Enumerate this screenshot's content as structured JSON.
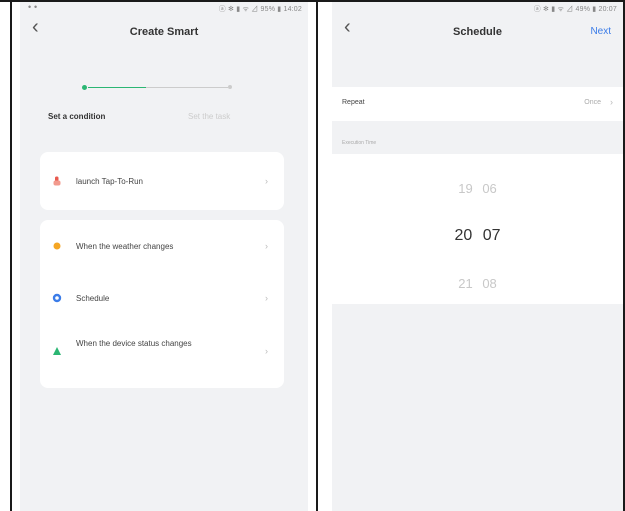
{
  "left_screen": {
    "status_left": "• •",
    "status_right": "ⓐ ✻ ▮ ᯤ ⊿ 95% ▮ 14:02",
    "title": "Create Smart",
    "steps": {
      "active_label": "Set a condition",
      "inactive_label": "Set the task"
    },
    "card1": [
      {
        "icon": "hand-icon",
        "label": "launch Tap-To-Run",
        "color": "#e85a4f"
      }
    ],
    "card2": [
      {
        "icon": "sun-icon",
        "label": "When the weather changes",
        "color": "#f5a623"
      },
      {
        "icon": "clock-icon",
        "label": "Schedule",
        "color": "#3b7ce8"
      },
      {
        "icon": "device-icon",
        "label": "When the device status changes",
        "color": "#2bb673"
      }
    ]
  },
  "right_screen": {
    "status_right": "ⓐ ✻ ▮ ᯤ ⊿ 49% ▮ 20:07",
    "title": "Schedule",
    "next_label": "Next",
    "repeat_label": "Repeat",
    "repeat_value": "Once",
    "section_label": "Execution Time",
    "time_rows": [
      {
        "hour": "19",
        "minute": "06"
      },
      {
        "hour": "20",
        "minute": "07"
      },
      {
        "hour": "21",
        "minute": "08"
      }
    ]
  },
  "colors": {
    "accent_green": "#2bb673",
    "link_blue": "#3b7ce8",
    "background": "#f1f2f4"
  }
}
